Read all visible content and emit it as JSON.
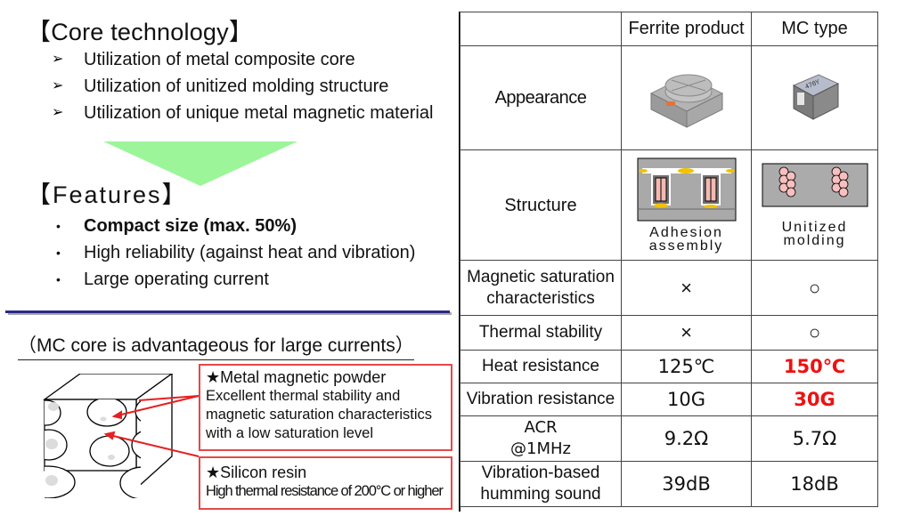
{
  "core_technology": {
    "title": "【Core technology】",
    "items": [
      {
        "icon": "arrow-bullet-icon",
        "glyph": "➢",
        "text": "Utilization of metal composite core"
      },
      {
        "icon": "arrow-bullet-icon",
        "glyph": "➢",
        "text": "Utilization of unitized molding structure"
      },
      {
        "icon": "arrow-bullet-icon",
        "glyph": "➢",
        "text": "Utilization of unique metal magnetic material"
      }
    ]
  },
  "arrow_color": "#9df59a",
  "features": {
    "title": "【Features】",
    "items": [
      {
        "glyph": "•",
        "text": "Compact size (max. 50%)",
        "bold": true
      },
      {
        "glyph": "•",
        "text": "High reliability (against heat and vibration)",
        "bold": false
      },
      {
        "glyph": "•",
        "text": "Large operating current",
        "bold": false
      }
    ]
  },
  "mc_core": {
    "subtitle": "（MC core is advantageous for large currents）",
    "callouts": [
      {
        "title": "★Metal magnetic powder",
        "lines": [
          "Excellent thermal stability and",
          "magnetic saturation characteristics",
          "with a low saturation level"
        ]
      },
      {
        "title": "★Silicon resin",
        "lines": [
          "High thermal resistance of 200°C or higher"
        ]
      }
    ],
    "accent_color": "#e54848"
  },
  "comparison_table": {
    "columns": [
      "",
      "Ferrite product",
      "MC type"
    ],
    "appearance_label": "Appearance",
    "structure": {
      "label": "Structure",
      "ferrite_caption": [
        "Adhesion",
        "assembly"
      ],
      "mc_caption": [
        "Unitized",
        "molding"
      ]
    },
    "rows": [
      {
        "label": "Magnetic saturation characteristics",
        "ferrite": "×",
        "mc": "○",
        "mc_highlight": false,
        "kind": "mark"
      },
      {
        "label": "Thermal stability",
        "ferrite": "×",
        "mc": "○",
        "mc_highlight": false,
        "kind": "mark"
      },
      {
        "label": "Heat resistance",
        "ferrite": "125℃",
        "mc": "150℃",
        "mc_highlight": true,
        "kind": "val"
      },
      {
        "label": "Vibration resistance",
        "ferrite": "10G",
        "mc": "30G",
        "mc_highlight": true,
        "kind": "val"
      },
      {
        "label": "ACR @1MHz",
        "ferrite": "9.2Ω",
        "mc": "5.7Ω",
        "mc_highlight": false,
        "kind": "val"
      },
      {
        "label": "Vibration-based humming sound",
        "ferrite": "39dB",
        "mc": "18dB",
        "mc_highlight": false,
        "kind": "val"
      }
    ],
    "highlight_color": "#ee1111"
  }
}
